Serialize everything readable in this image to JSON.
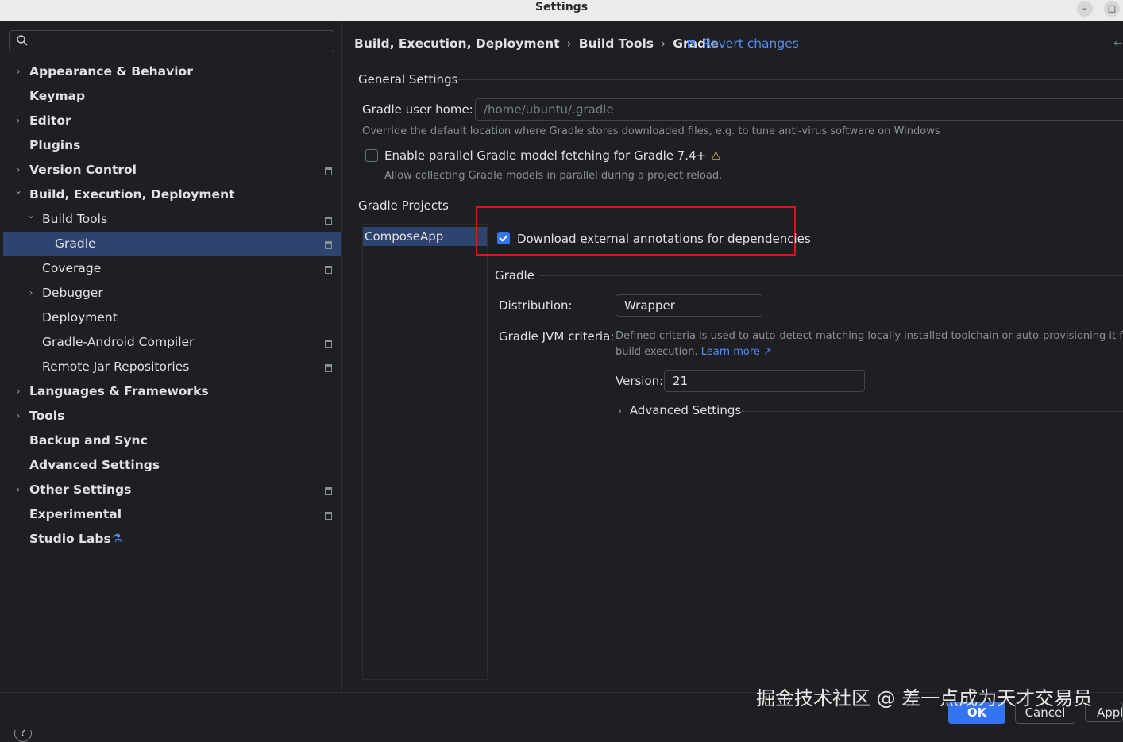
{
  "window": {
    "title": "Settings",
    "minimize": "–",
    "maximize": "□"
  },
  "sidebar": {
    "search_placeholder": "",
    "items": [
      {
        "label": "Appearance & Behavior",
        "level": 0,
        "expandable": true,
        "bold": true
      },
      {
        "label": "Keymap",
        "level": 0,
        "bold": true
      },
      {
        "label": "Editor",
        "level": 0,
        "expandable": true,
        "bold": true
      },
      {
        "label": "Plugins",
        "level": 0,
        "bold": true
      },
      {
        "label": "Version Control",
        "level": 0,
        "expandable": true,
        "bold": true
      },
      {
        "label": "Build, Execution, Deployment",
        "level": 0,
        "expanded": true,
        "bold": true
      },
      {
        "label": "Build Tools",
        "level": 1,
        "expanded": true
      },
      {
        "label": "Gradle",
        "level": 2,
        "selected": true
      },
      {
        "label": "Coverage",
        "level": 1
      },
      {
        "label": "Debugger",
        "level": 1,
        "expandable": true
      },
      {
        "label": "Deployment",
        "level": 1
      },
      {
        "label": "Gradle-Android Compiler",
        "level": 1
      },
      {
        "label": "Remote Jar Repositories",
        "level": 1
      },
      {
        "label": "Languages & Frameworks",
        "level": 0,
        "expandable": true,
        "bold": true
      },
      {
        "label": "Tools",
        "level": 0,
        "expandable": true,
        "bold": true
      },
      {
        "label": "Backup and Sync",
        "level": 0,
        "bold": true
      },
      {
        "label": "Advanced Settings",
        "level": 0,
        "bold": true
      },
      {
        "label": "Other Settings",
        "level": 0,
        "expandable": true,
        "bold": true
      },
      {
        "label": "Experimental",
        "level": 0,
        "bold": true
      },
      {
        "label": "Studio Labs",
        "level": 0,
        "bold": true
      }
    ],
    "help": "?"
  },
  "breadcrumb": {
    "parts": [
      "Build, Execution, Deployment",
      "Build Tools",
      "Gradle"
    ],
    "sep": "›",
    "revert": "Revert changes"
  },
  "general": {
    "section": "General Settings",
    "user_home_label": "Gradle user home:",
    "user_home_value": "/home/ubuntu/.gradle",
    "user_home_hint": "Override the default location where Gradle stores downloaded files, e.g. to tune anti-virus software on Windows",
    "parallel_label": "Enable parallel Gradle model fetching for Gradle 7.4+",
    "parallel_hint": "Allow collecting Gradle models in parallel during a project reload."
  },
  "projects": {
    "section": "Gradle Projects",
    "items": [
      "ComposeApp"
    ],
    "download_annotations_label": "Download external annotations for dependencies",
    "gradle_section": "Gradle",
    "distribution_label": "Distribution:",
    "distribution_value": "Wrapper",
    "jvm_label": "Gradle JVM criteria:",
    "jvm_hint_1": "Defined criteria is used to auto-detect matching locally installed toolchain or auto-provisioning it for the",
    "jvm_hint_2": "build execution.",
    "learn_more": "Learn more ↗",
    "version_label": "Version:",
    "version_value": "21",
    "advanced": "Advanced Settings"
  },
  "footer": {
    "ok": "OK",
    "cancel": "Cancel",
    "apply": "Apply"
  },
  "watermark": "掘金技术社区 @ 差一点成为天才交易员",
  "colors": {
    "accent": "#3574f0",
    "link": "#548af7",
    "highlight": "#e0121b",
    "selection": "#2e436e",
    "warning": "#f2c55c"
  }
}
